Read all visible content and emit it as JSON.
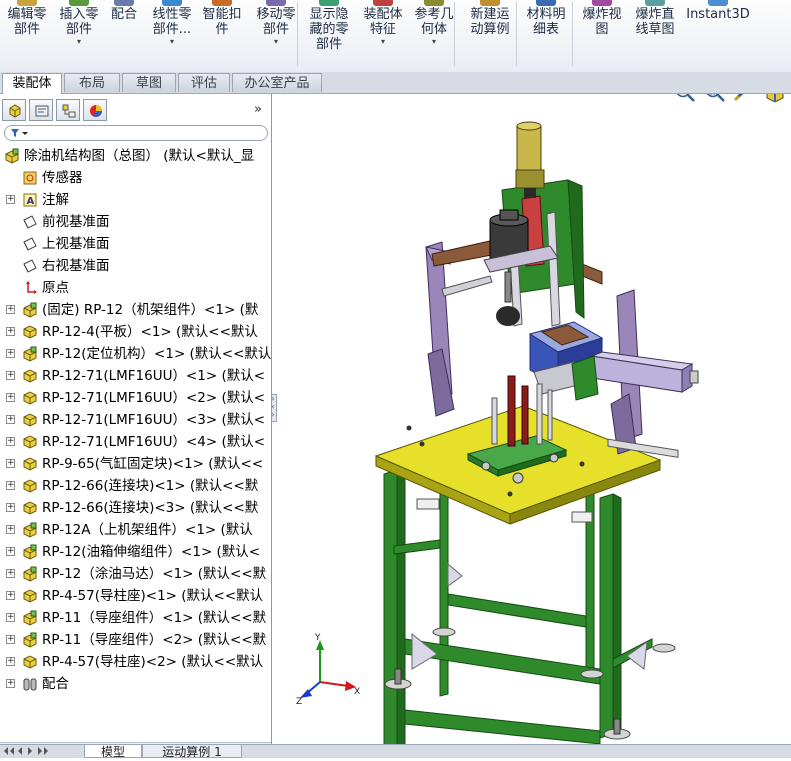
{
  "ribbon": {
    "buttons": [
      {
        "label": "编辑零\n部件",
        "dropdown": false,
        "icon": "edit-component-icon"
      },
      {
        "label": "插入零\n部件",
        "dropdown": true,
        "icon": "insert-component-icon"
      },
      {
        "label": "配合",
        "dropdown": false,
        "icon": "mate-icon"
      },
      {
        "label": "线性零\n部件...",
        "dropdown": true,
        "icon": "linear-pattern-icon"
      },
      {
        "label": "智能扣\n件",
        "dropdown": false,
        "icon": "smart-fastener-icon"
      },
      {
        "label": "移动零\n部件",
        "dropdown": true,
        "icon": "move-component-icon"
      },
      {
        "label": "显示隐\n藏的零\n部件",
        "dropdown": false,
        "icon": "show-hidden-icon"
      },
      {
        "label": "装配体\n特征",
        "dropdown": true,
        "icon": "assembly-feature-icon"
      },
      {
        "label": "参考几\n何体",
        "dropdown": true,
        "icon": "reference-geometry-icon"
      },
      {
        "label": "新建运\n动算例",
        "dropdown": false,
        "icon": "new-motion-study-icon"
      },
      {
        "label": "材料明\n细表",
        "dropdown": false,
        "icon": "bom-icon"
      },
      {
        "label": "爆炸视\n图",
        "dropdown": false,
        "icon": "exploded-view-icon"
      },
      {
        "label": "爆炸直\n线草图",
        "dropdown": false,
        "icon": "explode-line-sketch-icon"
      },
      {
        "label": "Instant3D",
        "dropdown": false,
        "icon": "instant3d-icon"
      }
    ]
  },
  "tabs": [
    "装配体",
    "布局",
    "草图",
    "评估",
    "办公室产品"
  ],
  "active_tab": "装配体",
  "panel": {
    "more_symbol": "»",
    "tree": [
      {
        "text": "除油机结构图（总图）  (默认<默认_显",
        "icon": "assembly",
        "expander": "",
        "level": 0
      },
      {
        "text": "传感器",
        "icon": "sensor",
        "expander": "",
        "level": 1
      },
      {
        "text": "注解",
        "icon": "annotation",
        "expander": "+",
        "level": 1
      },
      {
        "text": "前视基准面",
        "icon": "plane",
        "expander": "",
        "level": 1
      },
      {
        "text": "上视基准面",
        "icon": "plane",
        "expander": "",
        "level": 1
      },
      {
        "text": "右视基准面",
        "icon": "plane",
        "expander": "",
        "level": 1
      },
      {
        "text": "原点",
        "icon": "origin",
        "expander": "",
        "level": 1
      },
      {
        "text": "(固定) RP-12（机架组件）<1> (默",
        "icon": "subassembly",
        "expander": "+",
        "level": 1
      },
      {
        "text": "RP-12-4(平板）<1> (默认<<默认",
        "icon": "part",
        "expander": "+",
        "level": 1
      },
      {
        "text": "RP-12(定位机构）<1> (默认<<默认",
        "icon": "subassembly",
        "expander": "+",
        "level": 1
      },
      {
        "text": "RP-12-71(LMF16UU）<1> (默认<",
        "icon": "part",
        "expander": "+",
        "level": 1
      },
      {
        "text": "RP-12-71(LMF16UU）<2> (默认<",
        "icon": "part",
        "expander": "+",
        "level": 1
      },
      {
        "text": "RP-12-71(LMF16UU）<3> (默认<",
        "icon": "part",
        "expander": "+",
        "level": 1
      },
      {
        "text": "RP-12-71(LMF16UU）<4> (默认<",
        "icon": "part",
        "expander": "+",
        "level": 1
      },
      {
        "text": "RP-9-65(气缸固定块)<1> (默认<<",
        "icon": "part",
        "expander": "+",
        "level": 1
      },
      {
        "text": "RP-12-66(连接块)<1> (默认<<默",
        "icon": "part",
        "expander": "+",
        "level": 1
      },
      {
        "text": "RP-12-66(连接块)<3> (默认<<默",
        "icon": "part",
        "expander": "+",
        "level": 1
      },
      {
        "text": "RP-12A（上机架组件）<1> (默认",
        "icon": "subassembly",
        "expander": "+",
        "level": 1
      },
      {
        "text": "RP-12(油箱伸缩组件）<1> (默认<",
        "icon": "subassembly",
        "expander": "+",
        "level": 1
      },
      {
        "text": "RP-12（涂油马达）<1> (默认<<默",
        "icon": "subassembly",
        "expander": "+",
        "level": 1
      },
      {
        "text": "RP-4-57(导柱座)<1> (默认<<默认",
        "icon": "part",
        "expander": "+",
        "level": 1
      },
      {
        "text": "RP-11（导座组件）<1> (默认<<默",
        "icon": "subassembly",
        "expander": "+",
        "level": 1
      },
      {
        "text": "RP-11（导座组件）<2> (默认<<默",
        "icon": "subassembly",
        "expander": "+",
        "level": 1
      },
      {
        "text": "RP-4-57(导柱座)<2> (默认<<默认",
        "icon": "part",
        "expander": "+",
        "level": 1
      },
      {
        "text": "配合",
        "icon": "mates",
        "expander": "+",
        "level": 1
      }
    ]
  },
  "bottom_tabs": [
    "模型",
    "运动算例 1"
  ],
  "view_tools": [
    "zoom-to-fit-icon",
    "zoom-to-area-icon",
    "previous-view-icon",
    "section-view-icon"
  ],
  "triad": {
    "x": "X",
    "y": "Y",
    "z": "Z"
  },
  "colors": {
    "frame_green": "#2f8a2c",
    "table_yellow": "#e6e02a",
    "motor_khaki": "#c8b84a",
    "bracket_purple": "#9a86b8",
    "cylinder_lavender": "#bdb2dc",
    "arm_brown": "#8a5a3a",
    "box_blue": "#3b54b8",
    "rod_red": "#8b1a1a"
  }
}
